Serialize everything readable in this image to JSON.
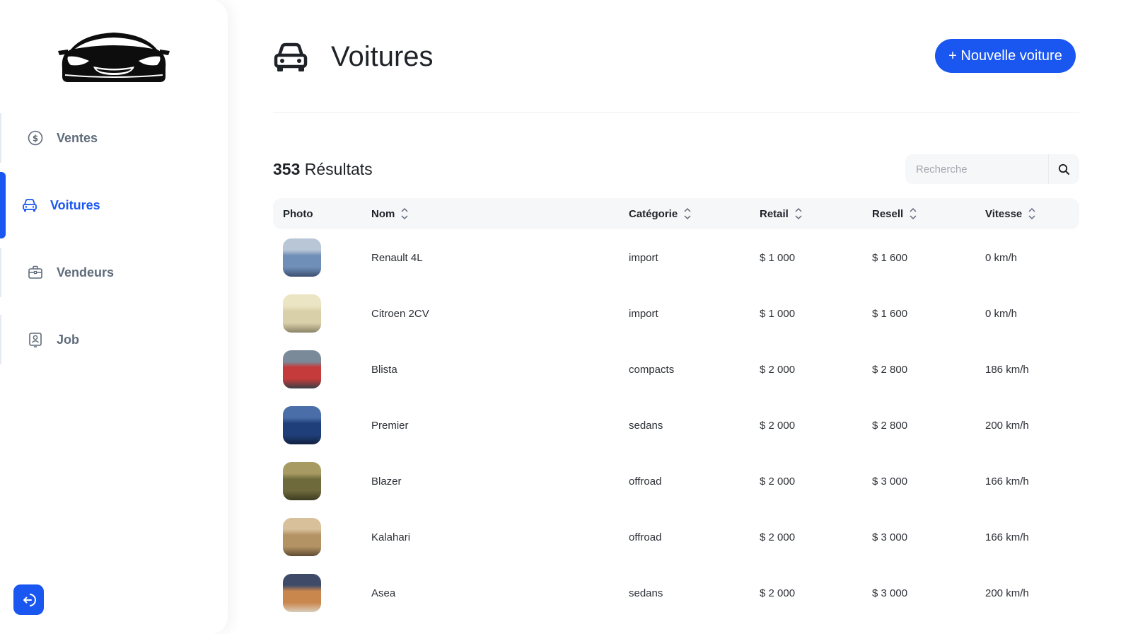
{
  "sidebar": {
    "logo_icon": "sports-car-logo",
    "items": [
      {
        "label": "Ventes",
        "icon": "dollar-circle-icon",
        "active": false
      },
      {
        "label": "Voitures",
        "icon": "car-icon",
        "active": true
      },
      {
        "label": "Vendeurs",
        "icon": "briefcase-icon",
        "active": false
      },
      {
        "label": "Job",
        "icon": "id-badge-icon",
        "active": false
      }
    ],
    "logout_icon": "logout-icon"
  },
  "header": {
    "title": "Voitures",
    "icon": "car-icon",
    "new_button_label": "+ Nouvelle voiture"
  },
  "results": {
    "count": "353",
    "label": "Résultats"
  },
  "search": {
    "placeholder": "Recherche",
    "icon": "search-icon"
  },
  "table": {
    "columns": [
      "Photo",
      "Nom",
      "Catégorie",
      "Retail",
      "Resell",
      "Vitesse"
    ],
    "rows": [
      {
        "name": "Renault 4L",
        "category": "import",
        "retail": "$ 1 000",
        "resell": "$ 1 600",
        "speed": "0 km/h",
        "thumb_colors": [
          "#6f8fb8",
          "#b9c6d6",
          "#3b4f70"
        ]
      },
      {
        "name": "Citroen 2CV",
        "category": "import",
        "retail": "$ 1 000",
        "resell": "$ 1 600",
        "speed": "0 km/h",
        "thumb_colors": [
          "#d9cfa8",
          "#ece5c4",
          "#8b8468"
        ]
      },
      {
        "name": "Blista",
        "category": "compacts",
        "retail": "$ 2 000",
        "resell": "$ 2 800",
        "speed": "186 km/h",
        "thumb_colors": [
          "#c53a3a",
          "#7a8a99",
          "#3a3f45"
        ]
      },
      {
        "name": "Premier",
        "category": "sedans",
        "retail": "$ 2 000",
        "resell": "$ 2 800",
        "speed": "200 km/h",
        "thumb_colors": [
          "#1f3f7a",
          "#4a6ea8",
          "#12213f"
        ]
      },
      {
        "name": "Blazer",
        "category": "offroad",
        "retail": "$ 2 000",
        "resell": "$ 3 000",
        "speed": "166 km/h",
        "thumb_colors": [
          "#6e6a3c",
          "#a79b63",
          "#3d3a22"
        ]
      },
      {
        "name": "Kalahari",
        "category": "offroad",
        "retail": "$ 2 000",
        "resell": "$ 3 000",
        "speed": "166 km/h",
        "thumb_colors": [
          "#b39263",
          "#d7c09a",
          "#5e4b33"
        ]
      },
      {
        "name": "Asea",
        "category": "sedans",
        "retail": "$ 2 000",
        "resell": "$ 3 000",
        "speed": "200 km/h",
        "thumb_colors": [
          "#c9864d",
          "#3f4a68",
          "#d9cdbb"
        ]
      }
    ]
  },
  "colors": {
    "accent": "#1a56f0",
    "muted_text": "#5f6b7a",
    "table_header_bg": "#f6f7f9"
  }
}
